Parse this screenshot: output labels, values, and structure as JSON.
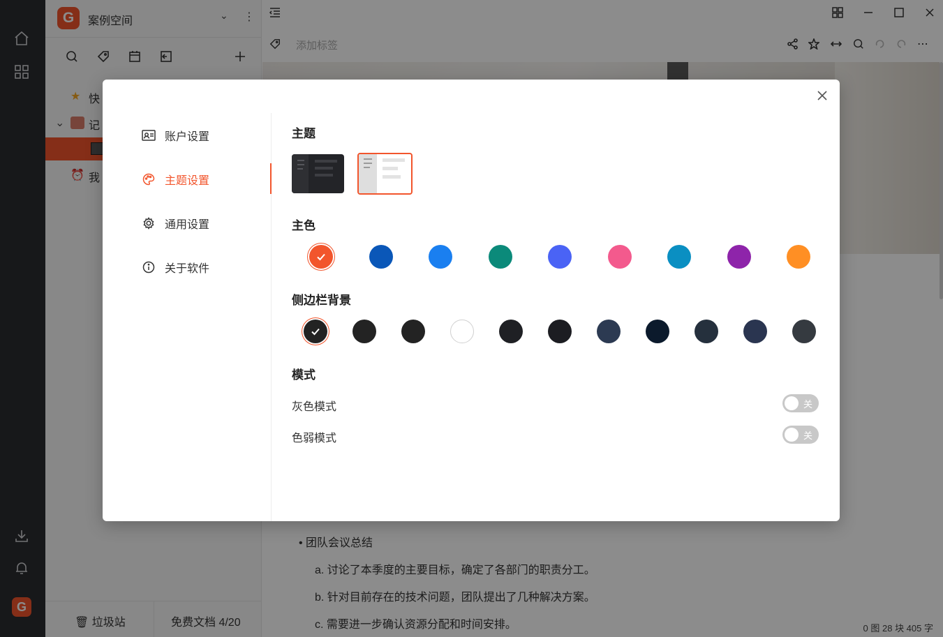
{
  "app": {
    "workspace_name": "案例空间",
    "ws_logo_letter": "G",
    "tag_placeholder": "添加标签",
    "tree": [
      {
        "label": "快"
      },
      {
        "label": "记"
      },
      {
        "label": ""
      },
      {
        "label": "我"
      }
    ],
    "footer": {
      "trash": "垃圾站",
      "quota": "免费文档 4/20"
    },
    "doc_lines": [
      "• 团队会议总结",
      "a. 讨论了本季度的主要目标，确定了各部门的职责分工。",
      "b. 针对目前存在的技术问题，团队提出了几种解决方案。",
      "c. 需要进一步确认资源分配和时间安排。"
    ],
    "status": "0 图   28 块   405 字",
    "accent": "#f2552c"
  },
  "dialog": {
    "nav": [
      {
        "label": "账户设置",
        "icon": "id-card-icon"
      },
      {
        "label": "主题设置",
        "icon": "palette-icon",
        "active": true
      },
      {
        "label": "通用设置",
        "icon": "gear-icon"
      },
      {
        "label": "关于软件",
        "icon": "info-icon"
      }
    ],
    "sections": {
      "theme": "主题",
      "primary_color": "主色",
      "sidebar_bg": "侧边栏背景",
      "mode": "模式"
    },
    "themes": [
      "dark",
      "light"
    ],
    "selected_theme": "light",
    "primary_colors": [
      "#f2552c",
      "#0a57b8",
      "#1a7ff0",
      "#0b8a7a",
      "#4a63f5",
      "#f35a8d",
      "#0a8fc2",
      "#8e24aa",
      "#ff8f24"
    ],
    "selected_primary": 0,
    "sidebar_colors": [
      "#232323",
      "#232323",
      "#232323",
      "#ffffff",
      "#1f2024",
      "#1c1d22",
      "#2c3a52",
      "#0b1a2c",
      "#25303d",
      "#2a3550",
      "#353a40"
    ],
    "selected_sidebar": 0,
    "modes": [
      {
        "label": "灰色模式",
        "state": "关",
        "on": false
      },
      {
        "label": "色弱模式",
        "state": "关",
        "on": false
      }
    ]
  }
}
